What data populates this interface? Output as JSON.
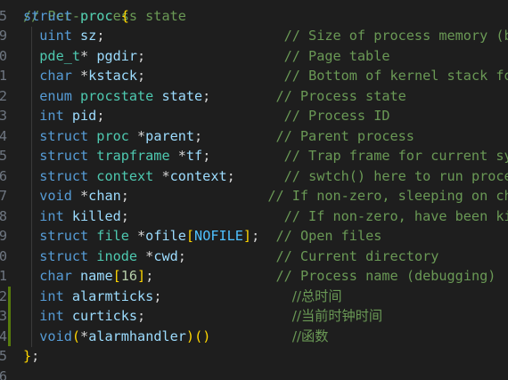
{
  "editor": {
    "top_partial_line": "// Per-process state",
    "lines": [
      {
        "gutter": "5",
        "modified": false,
        "parts": [
          {
            "c": "kw",
            "t": "struct "
          },
          {
            "c": "ty",
            "t": "proc "
          },
          {
            "c": "br",
            "t": "{"
          }
        ]
      },
      {
        "gutter": "9",
        "modified": false,
        "parts": [
          {
            "c": "kw",
            "t": "  uint "
          },
          {
            "c": "id",
            "t": "sz"
          },
          {
            "c": "pu",
            "t": ";                      "
          },
          {
            "c": "cm",
            "t": "// Size of process memory (bytes)"
          }
        ]
      },
      {
        "gutter": "0",
        "modified": false,
        "parts": [
          {
            "c": "ty",
            "t": "  pde_t"
          },
          {
            "c": "pu",
            "t": "* "
          },
          {
            "c": "id",
            "t": "pgdir"
          },
          {
            "c": "pu",
            "t": ";                 "
          },
          {
            "c": "cm",
            "t": "// Page table"
          }
        ]
      },
      {
        "gutter": "1",
        "modified": false,
        "parts": [
          {
            "c": "kw",
            "t": "  char "
          },
          {
            "c": "pu",
            "t": "*"
          },
          {
            "c": "id",
            "t": "kstack"
          },
          {
            "c": "pu",
            "t": ";                 "
          },
          {
            "c": "cm",
            "t": "// Bottom of kernel stack for this process"
          }
        ]
      },
      {
        "gutter": "2",
        "modified": false,
        "parts": [
          {
            "c": "kw",
            "t": "  enum "
          },
          {
            "c": "ty",
            "t": "procstate "
          },
          {
            "c": "id",
            "t": "state"
          },
          {
            "c": "pu",
            "t": ";        "
          },
          {
            "c": "cm",
            "t": "// Process state"
          }
        ]
      },
      {
        "gutter": "3",
        "modified": false,
        "parts": [
          {
            "c": "kw",
            "t": "  int "
          },
          {
            "c": "id",
            "t": "pid"
          },
          {
            "c": "pu",
            "t": ";                      "
          },
          {
            "c": "cm",
            "t": "// Process ID"
          }
        ]
      },
      {
        "gutter": "4",
        "modified": false,
        "parts": [
          {
            "c": "kw",
            "t": "  struct "
          },
          {
            "c": "ty",
            "t": "proc "
          },
          {
            "c": "pu",
            "t": "*"
          },
          {
            "c": "id",
            "t": "parent"
          },
          {
            "c": "pu",
            "t": ";         "
          },
          {
            "c": "cm",
            "t": "// Parent process"
          }
        ]
      },
      {
        "gutter": "5",
        "modified": false,
        "parts": [
          {
            "c": "kw",
            "t": "  struct "
          },
          {
            "c": "ty",
            "t": "trapframe "
          },
          {
            "c": "pu",
            "t": "*"
          },
          {
            "c": "id",
            "t": "tf"
          },
          {
            "c": "pu",
            "t": ";         "
          },
          {
            "c": "cm",
            "t": "// Trap frame for current syscall"
          }
        ]
      },
      {
        "gutter": "6",
        "modified": false,
        "parts": [
          {
            "c": "kw",
            "t": "  struct "
          },
          {
            "c": "ty",
            "t": "context "
          },
          {
            "c": "pu",
            "t": "*"
          },
          {
            "c": "id",
            "t": "context"
          },
          {
            "c": "pu",
            "t": ";      "
          },
          {
            "c": "cm",
            "t": "// swtch() here to run process"
          }
        ]
      },
      {
        "gutter": "7",
        "modified": false,
        "parts": [
          {
            "c": "kw",
            "t": "  void "
          },
          {
            "c": "pu",
            "t": "*"
          },
          {
            "c": "id",
            "t": "chan"
          },
          {
            "c": "pu",
            "t": ";                 "
          },
          {
            "c": "cm",
            "t": "// If non-zero, sleeping on chan"
          }
        ]
      },
      {
        "gutter": "8",
        "modified": false,
        "parts": [
          {
            "c": "kw",
            "t": "  int "
          },
          {
            "c": "id",
            "t": "killed"
          },
          {
            "c": "pu",
            "t": ";                   "
          },
          {
            "c": "cm",
            "t": "// If non-zero, have been killed"
          }
        ]
      },
      {
        "gutter": "9",
        "modified": false,
        "parts": [
          {
            "c": "kw",
            "t": "  struct "
          },
          {
            "c": "ty",
            "t": "file "
          },
          {
            "c": "pu",
            "t": "*"
          },
          {
            "c": "id",
            "t": "ofile"
          },
          {
            "c": "br",
            "t": "["
          },
          {
            "c": "mc",
            "t": "NOFILE"
          },
          {
            "c": "br",
            "t": "]"
          },
          {
            "c": "pu",
            "t": ";  "
          },
          {
            "c": "cm",
            "t": "// Open files"
          }
        ]
      },
      {
        "gutter": "0",
        "modified": false,
        "parts": [
          {
            "c": "kw",
            "t": "  struct "
          },
          {
            "c": "ty",
            "t": "inode "
          },
          {
            "c": "pu",
            "t": "*"
          },
          {
            "c": "id",
            "t": "cwd"
          },
          {
            "c": "pu",
            "t": ";           "
          },
          {
            "c": "cm",
            "t": "// Current directory"
          }
        ]
      },
      {
        "gutter": "1",
        "modified": false,
        "parts": [
          {
            "c": "kw",
            "t": "  char "
          },
          {
            "c": "id",
            "t": "name"
          },
          {
            "c": "br",
            "t": "["
          },
          {
            "c": "nm",
            "t": "16"
          },
          {
            "c": "br",
            "t": "]"
          },
          {
            "c": "pu",
            "t": ";               "
          },
          {
            "c": "cm",
            "t": "// Process name (debugging)"
          }
        ]
      },
      {
        "gutter": "2",
        "modified": true,
        "parts": [
          {
            "c": "kw",
            "t": "  int "
          },
          {
            "c": "id",
            "t": "alarmticks"
          },
          {
            "c": "pu",
            "t": ";                "
          },
          {
            "c": "cm cmt-cn",
            "t": "//总时间"
          }
        ]
      },
      {
        "gutter": "3",
        "modified": true,
        "parts": [
          {
            "c": "kw",
            "t": "  int "
          },
          {
            "c": "id",
            "t": "curticks"
          },
          {
            "c": "pu",
            "t": ";                  "
          },
          {
            "c": "cm cmt-cn",
            "t": "//当前时钟时间"
          }
        ]
      },
      {
        "gutter": "4",
        "modified": true,
        "parts": [
          {
            "c": "kw",
            "t": "  void"
          },
          {
            "c": "br",
            "t": "("
          },
          {
            "c": "pu",
            "t": "*"
          },
          {
            "c": "id",
            "t": "alarmhandler"
          },
          {
            "c": "br",
            "t": ")("
          },
          {
            "c": "br",
            "t": ")"
          },
          {
            "c": "pu",
            "t": "          "
          },
          {
            "c": "cm cmt-cn",
            "t": "//函数"
          }
        ]
      },
      {
        "gutter": "5",
        "modified": false,
        "parts": [
          {
            "c": "br",
            "t": "}"
          },
          {
            "c": "pu",
            "t": ";"
          }
        ]
      },
      {
        "gutter": "6",
        "modified": false,
        "parts": []
      }
    ]
  }
}
